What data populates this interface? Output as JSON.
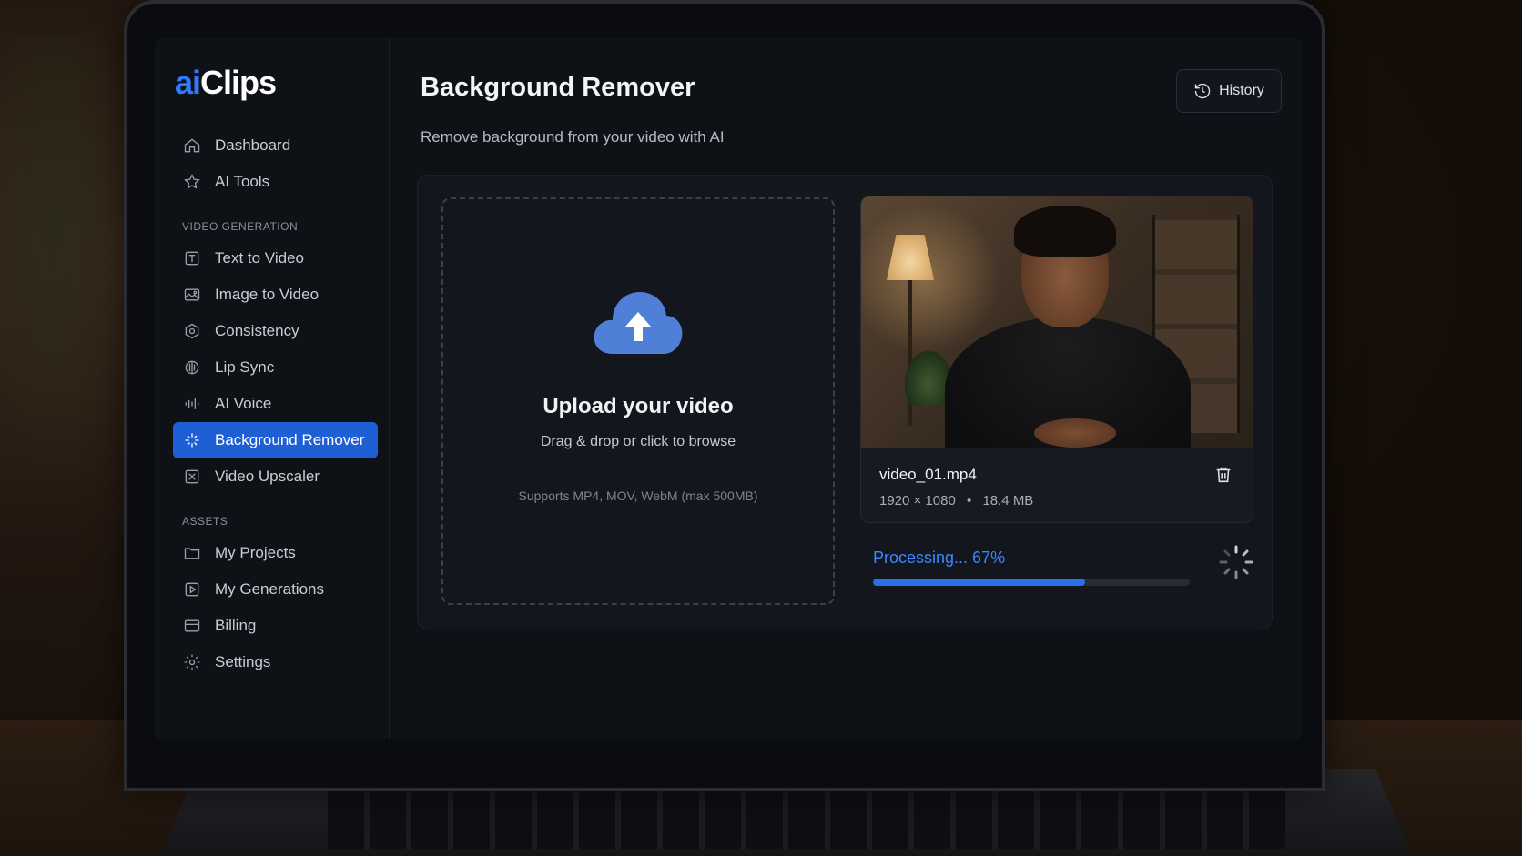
{
  "app": {
    "logo_prefix": "ai",
    "logo_suffix": "Clips"
  },
  "sidebar": {
    "top_items": [
      {
        "label": "Dashboard",
        "icon": "home-icon"
      },
      {
        "label": "AI Tools",
        "icon": "star-icon"
      }
    ],
    "sections": [
      {
        "label": "VIDEO GENERATION",
        "items": [
          {
            "label": "Text to Video",
            "icon": "text-box-icon"
          },
          {
            "label": "Image to Video",
            "icon": "image-icon"
          },
          {
            "label": "Consistency",
            "icon": "hexagon-icon"
          },
          {
            "label": "Lip Sync",
            "icon": "lip-sync-icon"
          },
          {
            "label": "AI Voice",
            "icon": "voice-icon"
          },
          {
            "label": "Background Remover",
            "icon": "sparkle-icon",
            "active": true
          },
          {
            "label": "Video Upscaler",
            "icon": "upscale-icon"
          }
        ]
      },
      {
        "label": "ASSETS",
        "items": [
          {
            "label": "My Projects",
            "icon": "folder-icon"
          },
          {
            "label": "My Generations",
            "icon": "play-square-icon"
          },
          {
            "label": "Billing",
            "icon": "card-icon"
          },
          {
            "label": "Settings",
            "icon": "gear-icon"
          }
        ]
      }
    ]
  },
  "header": {
    "title": "Background Remover",
    "subtitle": "Remove background from your video with AI",
    "history_label": "History"
  },
  "upload": {
    "title": "Upload your video",
    "hint": "Drag & drop or click to browse",
    "support": "Supports MP4, MOV, WebM (max 500MB)"
  },
  "file": {
    "name": "video_01.mp4",
    "resolution": "1920 × 1080",
    "separator": "•",
    "size": "18.4 MB"
  },
  "progress": {
    "label": "Processing... 67%",
    "value": 0.67
  },
  "colors": {
    "accent": "#2f7bff",
    "active_nav": "#1f5fd6",
    "progress": "#2a6eea",
    "background": "#0e1116"
  }
}
